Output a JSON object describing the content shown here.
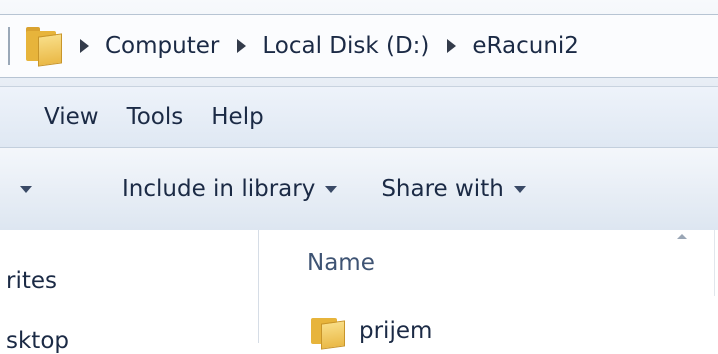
{
  "address": {
    "crumbs": [
      "Computer",
      "Local Disk (D:)",
      "eRacuni2"
    ]
  },
  "menu": {
    "items": [
      "View",
      "Tools",
      "Help"
    ]
  },
  "toolbar": {
    "include_label": "Include in library",
    "share_label": "Share with"
  },
  "nav": {
    "favorites_label": "rites",
    "desktop_label": "sktop"
  },
  "files": {
    "name_header": "Name",
    "rows": [
      {
        "name": "prijem"
      }
    ]
  },
  "icons": {
    "address_folder": "folder-icon",
    "row_folder": "folder-icon"
  }
}
